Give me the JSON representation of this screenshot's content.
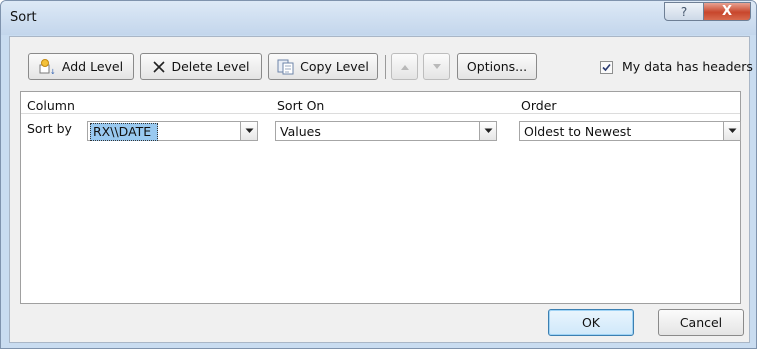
{
  "window": {
    "title": "Sort",
    "help_label": "?",
    "close_label": "X"
  },
  "toolbar": {
    "add_level": "Add Level",
    "delete_level": "Delete Level",
    "copy_level": "Copy Level",
    "options": "Options...",
    "my_data_has_headers": "My data has headers",
    "headers_checked": true
  },
  "grid": {
    "headers": [
      "Column",
      "Sort On",
      "Order"
    ],
    "rows": [
      {
        "label": "Sort by",
        "column": "RX\\\\DATE",
        "sort_on": "Values",
        "order": "Oldest to Newest"
      }
    ]
  },
  "footer": {
    "ok": "OK",
    "cancel": "Cancel"
  },
  "colors": {
    "accent_selection": "#99c9f0",
    "close_button": "#c8462c"
  }
}
